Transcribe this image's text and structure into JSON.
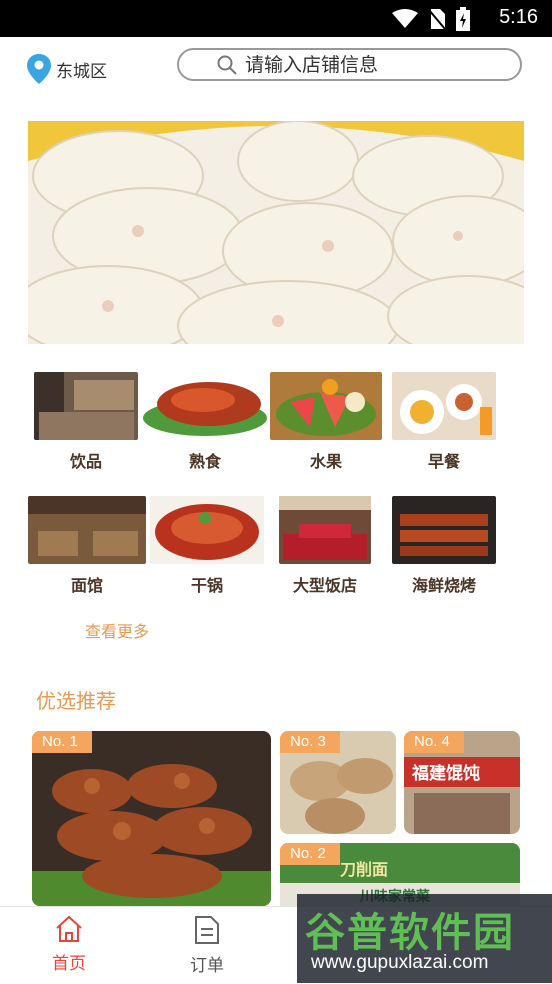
{
  "status_bar": {
    "time": "5:16"
  },
  "header": {
    "location": "东城区",
    "search_placeholder": "请输入店铺信息"
  },
  "categories": [
    {
      "label": "饮品"
    },
    {
      "label": "熟食"
    },
    {
      "label": "水果"
    },
    {
      "label": "早餐"
    },
    {
      "label": "面馆"
    },
    {
      "label": "干锅"
    },
    {
      "label": "大型饭店"
    },
    {
      "label": "海鲜烧烤"
    }
  ],
  "more_link": "查看更多",
  "recommend": {
    "title": "优选推荐",
    "cards": [
      {
        "rank": "No. 1"
      },
      {
        "rank": "No. 3"
      },
      {
        "rank": "No. 4"
      },
      {
        "rank": "No. 2"
      }
    ]
  },
  "signs": {
    "no4": "福建馄饨",
    "no2_top": "刀削面",
    "no2_bottom": "川味家常菜"
  },
  "bottom_nav": {
    "tabs": [
      {
        "label": "首页",
        "active": true
      },
      {
        "label": "订单",
        "active": false
      }
    ]
  },
  "watermark": {
    "brand": "谷普软件园",
    "url": "www.gupuxlazai.com"
  },
  "colors": {
    "accent": "#e79a52",
    "active_tab": "#e8443a",
    "label": "#4a3526"
  }
}
